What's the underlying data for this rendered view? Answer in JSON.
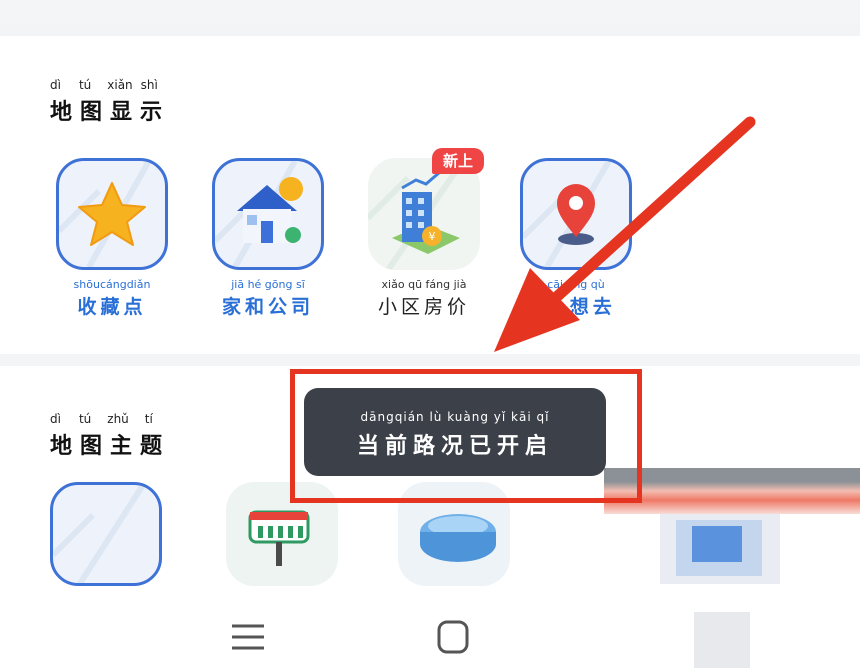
{
  "section1": {
    "title_pinyin": [
      "dì",
      "tú",
      "xiǎn",
      "shì"
    ],
    "title": [
      "地",
      "图",
      "显",
      "示"
    ]
  },
  "section2": {
    "title_pinyin": [
      "dì",
      "tú",
      "zhǔ",
      "tí"
    ],
    "title": [
      "地",
      "图",
      "主",
      "题"
    ]
  },
  "display_items": [
    {
      "pinyin": "shōucángdiǎn",
      "label": "收藏点",
      "icon": "star-icon"
    },
    {
      "pinyin": "jiā  hé  gōng  sī",
      "label": "家和公司",
      "icon": "house-icon"
    },
    {
      "pinyin": "xiǎo  qū  fáng  jià",
      "label": "小区房价",
      "icon": "building-price-icon"
    },
    {
      "pinyin": "cāi        ǎng  qù",
      "label": "猜     想去",
      "icon": "location-pin-icon"
    }
  ],
  "badge": "新上",
  "toast": {
    "pinyin": "dāngqián  lù  kuàng  yǐ  kāi  qǐ",
    "text": "当前路况已开启"
  },
  "colors": {
    "accent": "#2a6fd6",
    "annotation": "#e5341f",
    "badge": "#f04545",
    "toast_bg": "#3c4048"
  }
}
